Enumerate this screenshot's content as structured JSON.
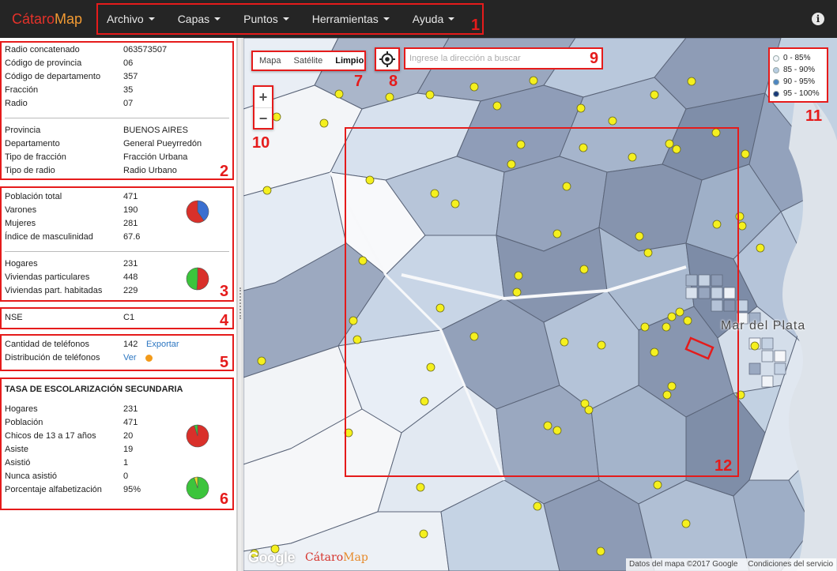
{
  "app": {
    "brand_a": "Cátaro",
    "brand_b": "Map"
  },
  "menu": [
    {
      "label": "Archivo"
    },
    {
      "label": "Capas"
    },
    {
      "label": "Puntos"
    },
    {
      "label": "Herramientas"
    },
    {
      "label": "Ayuda"
    }
  ],
  "callouts": [
    "1",
    "2",
    "3",
    "4",
    "5",
    "6",
    "7",
    "8",
    "9",
    "10",
    "11",
    "12"
  ],
  "section_location": {
    "rows_a": [
      {
        "k": "Radio concatenado",
        "v": "063573507"
      },
      {
        "k": "Código de provincia",
        "v": "06"
      },
      {
        "k": "Código de departamento",
        "v": "357"
      },
      {
        "k": "Fracción",
        "v": "35"
      },
      {
        "k": "Radio",
        "v": "07"
      }
    ],
    "rows_b": [
      {
        "k": "Provincia",
        "v": "BUENOS AIRES"
      },
      {
        "k": "Departamento",
        "v": "General Pueyrredón"
      },
      {
        "k": "Tipo de fracción",
        "v": "Fracción Urbana"
      },
      {
        "k": "Tipo de radio",
        "v": "Radio Urbano"
      }
    ]
  },
  "section_population": {
    "rows_a": [
      {
        "k": "Población total",
        "v": "471"
      },
      {
        "k": "Varones",
        "v": "190"
      },
      {
        "k": "Mujeres",
        "v": "281"
      },
      {
        "k": "Índice de masculinidad",
        "v": "67.6"
      }
    ],
    "rows_b": [
      {
        "k": "Hogares",
        "v": "231"
      },
      {
        "k": "Viviendas particulares",
        "v": "448"
      },
      {
        "k": "Viviendas part. habitadas",
        "v": "229"
      }
    ],
    "pie_gender": {
      "male": 190,
      "female": 281,
      "colors": [
        "#3a6fd0",
        "#d9302a"
      ]
    },
    "pie_housing": {
      "inhabited": 229,
      "other": 219,
      "colors": [
        "#d9302a",
        "#3cc43c"
      ]
    }
  },
  "section_nse": {
    "k": "NSE",
    "v": "C1"
  },
  "section_phones": {
    "count_label": "Cantidad de teléfonos",
    "count_value": "142",
    "export_link": "Exportar",
    "dist_label": "Distribución de teléfonos",
    "dist_link": "Ver",
    "dot_color": "#f29a1a"
  },
  "section_school": {
    "title": "TASA DE ESCOLARIZACIÓN SECUNDARIA",
    "rows": [
      {
        "k": "Hogares",
        "v": "231"
      },
      {
        "k": "Población",
        "v": "471"
      },
      {
        "k": "Chicos de 13 a 17 años",
        "v": "20"
      },
      {
        "k": "Asiste",
        "v": "19"
      },
      {
        "k": "Asistió",
        "v": "1"
      },
      {
        "k": "Nunca asistió",
        "v": "0"
      },
      {
        "k": "Porcentaje alfabetización",
        "v": "95%"
      }
    ],
    "pie_attend": {
      "asiste": 19,
      "asistio": 1,
      "nunca": 0,
      "colors": [
        "#d9302a",
        "#3cc43c",
        "#e8e02a"
      ]
    },
    "pie_literacy": {
      "value": 95,
      "colors": [
        "#3cc43c",
        "#e8e02a"
      ]
    }
  },
  "map": {
    "types": [
      "Mapa",
      "Satélite",
      "Limpio"
    ],
    "active_type": "Limpio",
    "search_placeholder": "Ingrese la dirección a buscar",
    "zoom_in": "+",
    "zoom_out": "−",
    "city_label": "Mar del Plata",
    "google": "Google",
    "attribution": "Datos del mapa ©2017 Google",
    "terms": "Condiciones del servicio",
    "legend": [
      {
        "label": "0 - 85%",
        "color": "#f4f6fa"
      },
      {
        "label": "85 - 90%",
        "color": "#b8cde2"
      },
      {
        "label": "90 - 95%",
        "color": "#4d86c2"
      },
      {
        "label": "95 - 100%",
        "color": "#1a3a78"
      }
    ]
  }
}
